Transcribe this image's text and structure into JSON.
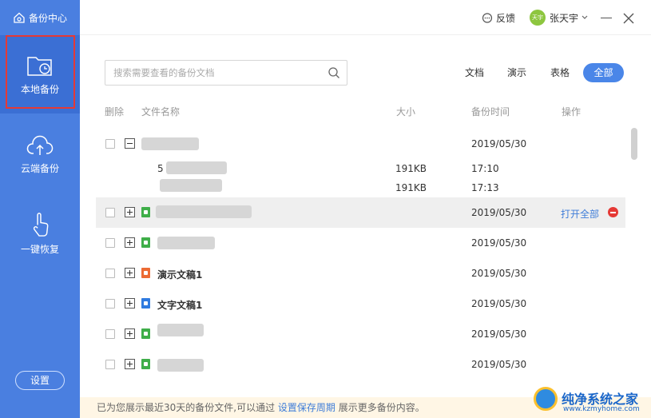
{
  "sidebar": {
    "brand": "备份中心",
    "items": [
      {
        "label": "本地备份",
        "icon": "folder-clock-icon",
        "active": true
      },
      {
        "label": "云端备份",
        "icon": "cloud-upload-icon"
      },
      {
        "label": "一键恢复",
        "icon": "tap-hand-icon"
      }
    ],
    "settings_label": "设置"
  },
  "topbar": {
    "feedback_label": "反馈",
    "avatar_text": "天宇",
    "username": "张天宇"
  },
  "search": {
    "placeholder": "搜索需要查看的备份文档"
  },
  "filters": {
    "doc": "文档",
    "show": "演示",
    "sheet": "表格",
    "all": "全部",
    "active": "all"
  },
  "table": {
    "headers": {
      "delete": "删除",
      "name": "文件名称",
      "size": "大小",
      "time": "备份时间",
      "action": "操作"
    },
    "rows": [
      {
        "name": "",
        "date": "2019/05/30",
        "expanded": true,
        "children": [
          {
            "name": "5",
            "size": "191KB",
            "time": "17:10"
          },
          {
            "name": "",
            "size": "191KB",
            "time": "17:13"
          }
        ]
      },
      {
        "name": "",
        "date": "2019/05/30",
        "type": "sheet",
        "selected": true,
        "action": "打开全部"
      },
      {
        "name": "",
        "date": "2019/05/30",
        "type": "sheet"
      },
      {
        "name": "演示文稿1",
        "date": "2019/05/30",
        "type": "presentation"
      },
      {
        "name": "文字文稿1",
        "date": "2019/05/30",
        "type": "document"
      },
      {
        "name": "",
        "date": "2019/05/30",
        "type": "sheet"
      },
      {
        "name": "",
        "date": "2019/05/30",
        "type": "sheet"
      }
    ]
  },
  "notice": {
    "before": "已为您展示最近30天的备份文件,可以通过",
    "link": "设置保存周期",
    "after": "展示更多备份内容。"
  },
  "watermark": {
    "title": "纯净系统之家",
    "url": "www.kzmyhome.com"
  },
  "colors": {
    "sidebar": "#4a7fe0",
    "accent": "#4a86e8",
    "link": "#3f7dd8",
    "delete": "#e53935"
  }
}
